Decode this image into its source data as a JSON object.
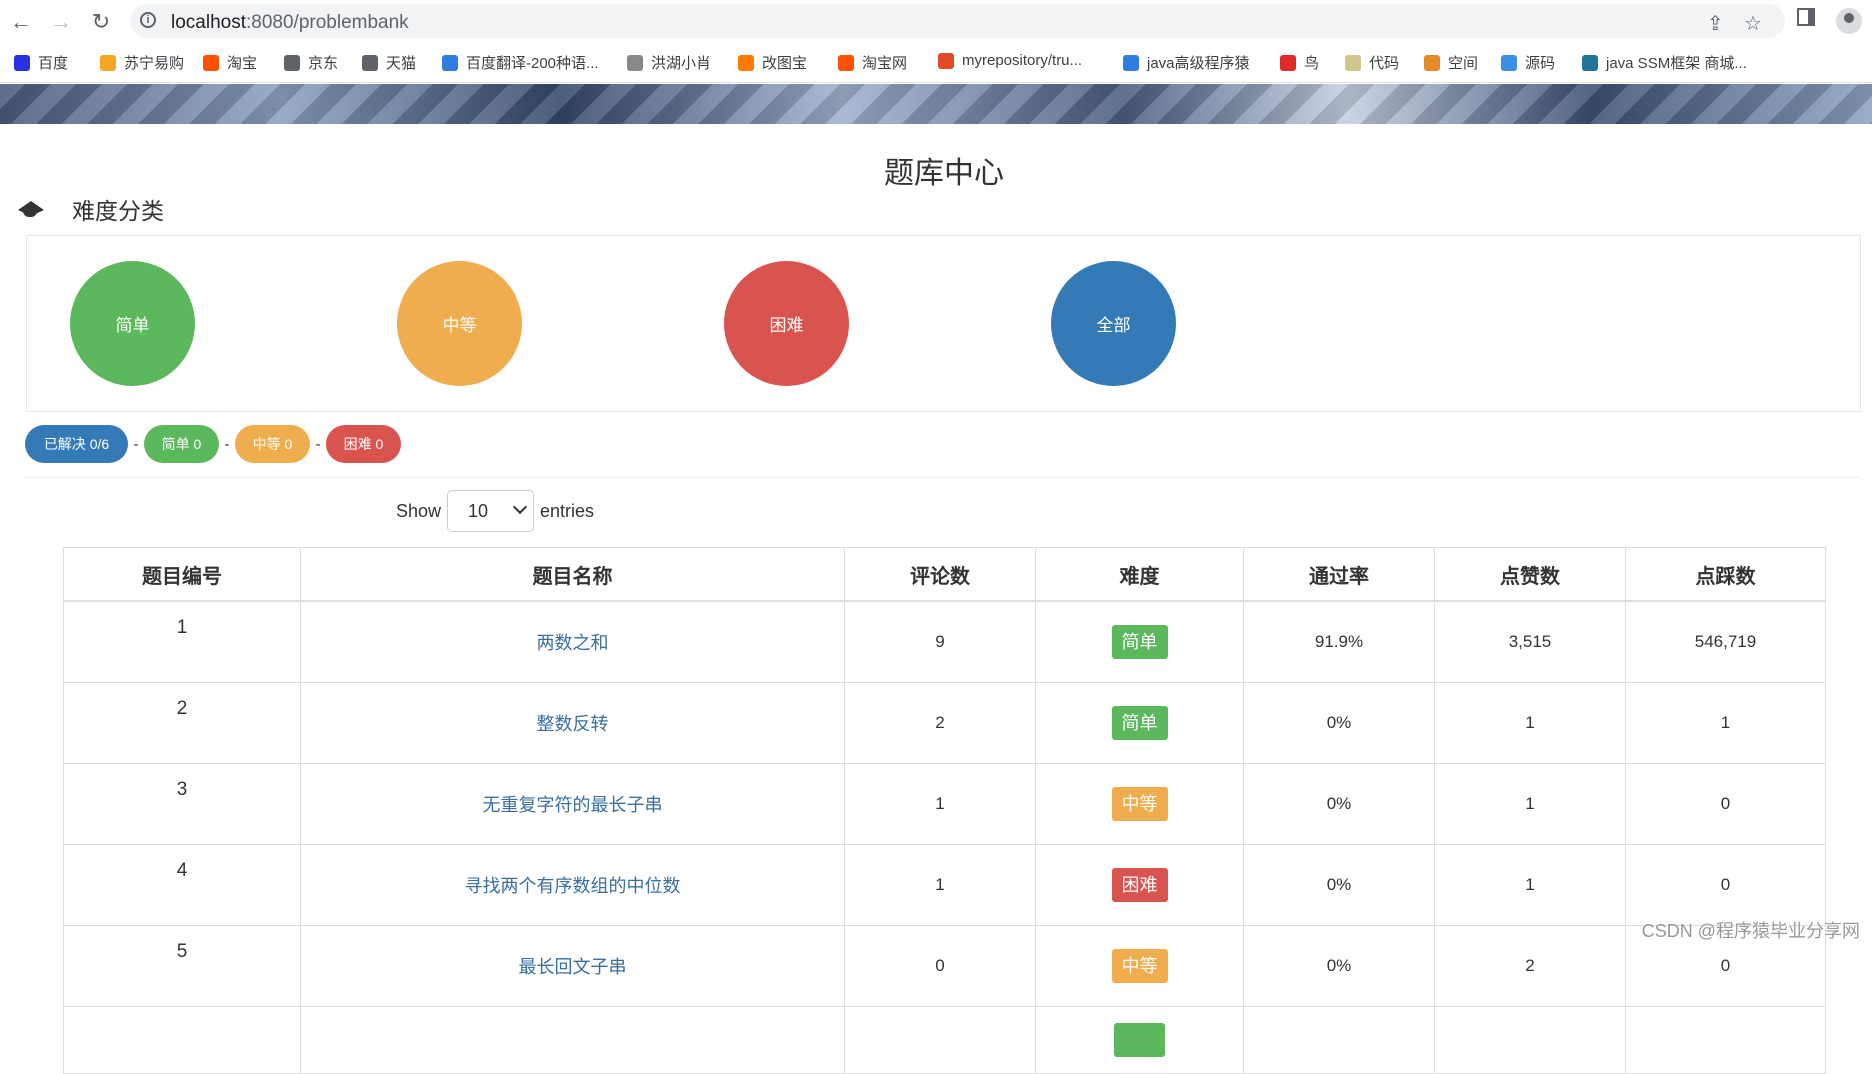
{
  "browser": {
    "url_host": "localhost",
    "url_path": ":8080/problembank"
  },
  "bookmarks": [
    {
      "label": "百度",
      "color": "#2932e1"
    },
    {
      "label": "苏宁易购",
      "color": "#f5a623"
    },
    {
      "label": "淘宝",
      "color": "#ff5000"
    },
    {
      "label": "京东",
      "color": "#5f6368"
    },
    {
      "label": "天猫",
      "color": "#5f6368"
    },
    {
      "label": "百度翻译-200种语...",
      "color": "#2f7de1"
    },
    {
      "label": "洪湖小肖",
      "color": "#888888"
    },
    {
      "label": "改图宝",
      "color": "#ff7a00"
    },
    {
      "label": "淘宝网",
      "color": "#ff5000"
    },
    {
      "label": "myrepository/tru...",
      "color": "#e04b2a"
    },
    {
      "label": "java高级程序猿",
      "color": "#2f7de1"
    },
    {
      "label": "鸟",
      "color": "#e02b2b"
    },
    {
      "label": "代码",
      "color": "#cfc88a"
    },
    {
      "label": "空间",
      "color": "#e58a2b"
    },
    {
      "label": "源码",
      "color": "#3a8ee6"
    },
    {
      "label": "java SSM框架 商城...",
      "color": "#21759b"
    }
  ],
  "page": {
    "title": "题库中心",
    "section_title": "难度分类"
  },
  "categories": [
    {
      "label": "简单",
      "color": "#5cb85c"
    },
    {
      "label": "中等",
      "color": "#f0ad4e"
    },
    {
      "label": "困难",
      "color": "#d9534f"
    },
    {
      "label": "全部",
      "color": "#337ab7"
    }
  ],
  "stats": {
    "solved": "已解决 0/6",
    "easy": "简单 0",
    "medium": "中等 0",
    "hard": "困难 0",
    "separator": "-"
  },
  "length_menu": {
    "show": "Show",
    "value": "10",
    "entries": "entries"
  },
  "table": {
    "headers": [
      "题目编号",
      "题目名称",
      "评论数",
      "难度",
      "通过率",
      "点赞数",
      "点踩数"
    ],
    "rows": [
      {
        "id": "1",
        "name": "两数之和",
        "comments": "9",
        "difficulty": "简单",
        "level": "easy",
        "pass_rate": "91.9%",
        "likes": "3,515",
        "dislikes": "546,719"
      },
      {
        "id": "2",
        "name": "整数反转",
        "comments": "2",
        "difficulty": "简单",
        "level": "easy",
        "pass_rate": "0%",
        "likes": "1",
        "dislikes": "1"
      },
      {
        "id": "3",
        "name": "无重复字符的最长子串",
        "comments": "1",
        "difficulty": "中等",
        "level": "medium",
        "pass_rate": "0%",
        "likes": "1",
        "dislikes": "0"
      },
      {
        "id": "4",
        "name": "寻找两个有序数组的中位数",
        "comments": "1",
        "difficulty": "困难",
        "level": "hard",
        "pass_rate": "0%",
        "likes": "1",
        "dislikes": "0"
      },
      {
        "id": "5",
        "name": "最长回文子串",
        "comments": "0",
        "difficulty": "中等",
        "level": "medium",
        "pass_rate": "0%",
        "likes": "2",
        "dislikes": "0"
      }
    ]
  },
  "watermark": "CSDN @程序猿毕业分享网"
}
